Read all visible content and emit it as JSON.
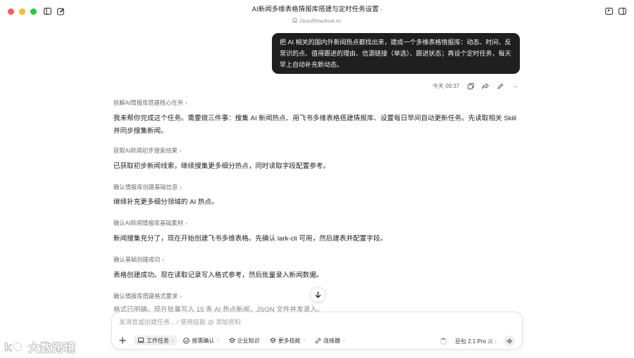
{
  "window": {
    "title": "AI新闻多维表格情报库搭建与定时任务设置",
    "device": "Zihao的MacBook Air"
  },
  "user_message": {
    "text": "把 AI 相关的国内外新闻热点都找出来，建成一个多维表格情报库：动态、时间、反常识的点、值得跟进的理由、信源链接（单选）、跟进状态；再设个定时任务，每天早上自动补充新动态。",
    "time": "今天 09:37"
  },
  "steps": [
    {
      "label": "拆解AI情报库搭建核心任务",
      "text": "我来帮你完成这个任务。需要做三件事：搜集 AI 新闻热点、用飞书多维表格搭建情报库、设置每日早间自动更新任务。先读取相关 Skill 并同步搜集新闻。"
    },
    {
      "label": "获取AI新闻初步搜索结果",
      "text": "已获取初步新闻线索，继续搜集更多细分热点，同时读取字段配置参考。"
    },
    {
      "label": "确认情报库创建基础信息",
      "text": "继续补充更多细分领域的 AI 热点。"
    },
    {
      "label": "确认AI新闻情报库基础素材",
      "text": "新闻搜集充分了，现在开始创建飞书多维表格。先确认 lark-cli 可用，然后建表并配置字段。"
    },
    {
      "label": "确认基础创建成功",
      "text": "表格创建成功。现在读取记录写入格式参考，然后批量录入新闻数据。"
    },
    {
      "label": "确认情报库搭建格式要求",
      "text": "格式已明确。现在批量写入 15 条 AI 热点新闻，JSON 文件并发录入。"
    }
  ],
  "composer": {
    "placeholder": "发消息或创建任务... / 使用技能 @ 添加资料",
    "tools": [
      "工作任务",
      "按需确认",
      "企业知识",
      "更多技能",
      "连接器"
    ],
    "model": "豆包 2.1 Pro",
    "model_mode": "高"
  },
  "watermark": {
    "text": "大数跨境"
  },
  "icons": {
    "sidebar": "sidebar-toggle-icon",
    "new_chat": "edit-icon",
    "share": "share-icon",
    "panel": "panel-icon",
    "scroll": "arrow-down-icon"
  },
  "colors": {
    "bubble": "#1f1f1f",
    "accent": "#28c840"
  }
}
